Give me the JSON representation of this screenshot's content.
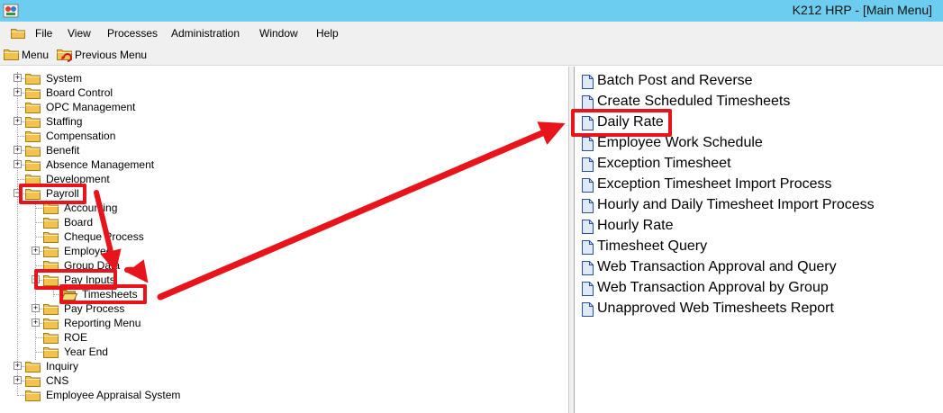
{
  "window": {
    "title": "K212 HRP - [Main Menu]",
    "app_icon": "app-logo-icon"
  },
  "menubar": {
    "items": [
      "File",
      "View",
      "Processes",
      "Administration",
      "Window",
      "Help"
    ]
  },
  "toolbar": {
    "menu_label": "Menu",
    "previous_label": "Previous Menu"
  },
  "tree": {
    "items": [
      {
        "label": "System",
        "expandable": true
      },
      {
        "label": "Board Control",
        "expandable": true
      },
      {
        "label": "OPC Management",
        "expandable": false
      },
      {
        "label": "Staffing",
        "expandable": true
      },
      {
        "label": "Compensation",
        "expandable": false
      },
      {
        "label": "Benefit",
        "expandable": true
      },
      {
        "label": "Absence Management",
        "expandable": true
      },
      {
        "label": "Development",
        "expandable": false
      },
      {
        "label": "Payroll",
        "expandable": true,
        "expanded": true
      },
      {
        "label": "Accounting",
        "expandable": false
      },
      {
        "label": "Board",
        "expandable": false
      },
      {
        "label": "Cheque Process",
        "expandable": false
      },
      {
        "label": "Employee",
        "expandable": true
      },
      {
        "label": "Group Data",
        "expandable": false
      },
      {
        "label": "Pay Inputs",
        "expandable": true,
        "expanded": true
      },
      {
        "label": "Timesheets",
        "expandable": false,
        "open": true
      },
      {
        "label": "Pay Process",
        "expandable": true
      },
      {
        "label": "Reporting Menu",
        "expandable": true
      },
      {
        "label": "ROE",
        "expandable": false
      },
      {
        "label": "Year End",
        "expandable": false
      },
      {
        "label": "Inquiry",
        "expandable": true
      },
      {
        "label": "CNS",
        "expandable": true
      },
      {
        "label": "Employee Appraisal System",
        "expandable": false
      }
    ]
  },
  "list": {
    "items": [
      "Batch Post and Reverse",
      "Create Scheduled Timesheets",
      "Daily Rate",
      "Employee Work Schedule",
      "Exception Timesheet",
      "Exception Timesheet Import Process",
      "Hourly and Daily Timesheet Import Process",
      "Hourly Rate",
      "Timesheet Query",
      "Web Transaction Approval and Query",
      "Web Transaction Approval by Group",
      "Unapproved Web Timesheets Report"
    ]
  },
  "colors": {
    "titlebar": "#6ccdf0",
    "chrome": "#f0f0f0",
    "highlight": "#e8141c",
    "folder": "#f2c14e",
    "document": "#dfe9f7"
  }
}
